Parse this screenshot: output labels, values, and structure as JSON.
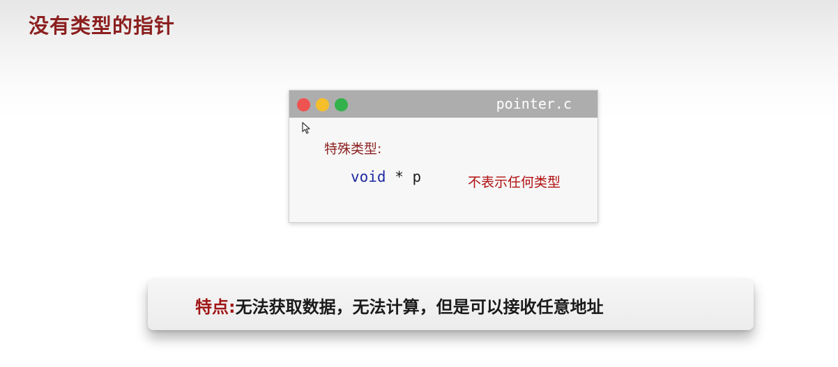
{
  "slide": {
    "title": "没有类型的指针"
  },
  "code_window": {
    "filename": "pointer.c",
    "special_label": "特殊类型:",
    "code_keyword": "void",
    "code_rest": " * p",
    "note": "不表示任何类型",
    "window_buttons": [
      "close-dot",
      "minimize-dot",
      "maximize-dot"
    ]
  },
  "callout": {
    "label": "特点:",
    "body": "无法获取数据，无法计算，但是可以接收任意地址"
  },
  "colors": {
    "title_red": "#8c1f1f",
    "keyword_blue": "#1f2aa0",
    "note_red": "#b00f0f",
    "dot_red": "#ef5350",
    "dot_yellow": "#f5bf2c",
    "dot_green": "#33b24c",
    "titlebar_gray": "#adadad"
  }
}
